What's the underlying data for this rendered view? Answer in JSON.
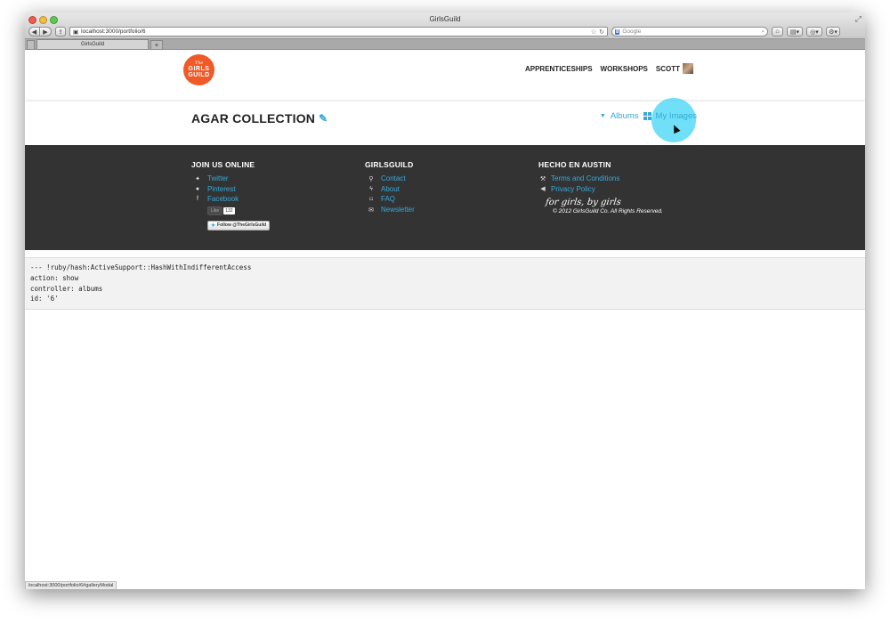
{
  "window": {
    "title": "GirlsGuild"
  },
  "browser": {
    "url": "localhost:3000/portfolio/6",
    "search_placeholder": "Google",
    "search_engine_label": "8",
    "tab_label": "GirlsGuild",
    "new_tab_label": "+",
    "status_url": "localhost:3000/portfolio/6#galleryModal"
  },
  "header": {
    "logo": {
      "the": "The",
      "line1": "GIRLS",
      "line2": "GUILD"
    },
    "nav": [
      "APPRENTICESHIPS",
      "WORKSHOPS",
      "SCOTT"
    ]
  },
  "page": {
    "title": "AGAR COLLECTION",
    "albums_label": "Albums",
    "my_images_label": "My Images"
  },
  "footer": {
    "col1": {
      "heading": "JOIN US ONLINE",
      "links": [
        {
          "icon": "twitter-icon",
          "label": "Twitter"
        },
        {
          "icon": "pinterest-icon",
          "label": "Pinterest"
        },
        {
          "icon": "facebook-icon",
          "label": "Facebook"
        }
      ],
      "like_label": "Like",
      "like_count": "132",
      "follow_label": "Follow @TheGirlsGuild"
    },
    "col2": {
      "heading": "GIRLSGUILD",
      "links": [
        {
          "icon": "map-pin-icon",
          "label": "Contact"
        },
        {
          "icon": "lightning-icon",
          "label": "About"
        },
        {
          "icon": "bookmark-icon",
          "label": "FAQ"
        },
        {
          "icon": "envelope-icon",
          "label": "Newsletter"
        }
      ]
    },
    "col3": {
      "heading": "HECHO EN AUSTIN",
      "links": [
        {
          "icon": "gavel-icon",
          "label": "Terms and Conditions"
        },
        {
          "icon": "megaphone-icon",
          "label": "Privacy Policy"
        }
      ],
      "signature": "for girls, by girls",
      "copyright": "© 2012 GirlsGuild Co. All Rights Reserved."
    }
  },
  "debug": {
    "lines": [
      "--- !ruby/hash:ActiveSupport::HashWithIndifferentAccess",
      "action: show",
      "controller: albums",
      "id: '6'"
    ]
  },
  "colors": {
    "accent": "#36a9d9",
    "logo": "#f05a28",
    "footer_bg": "#333333",
    "highlight": "#40d6f6"
  }
}
